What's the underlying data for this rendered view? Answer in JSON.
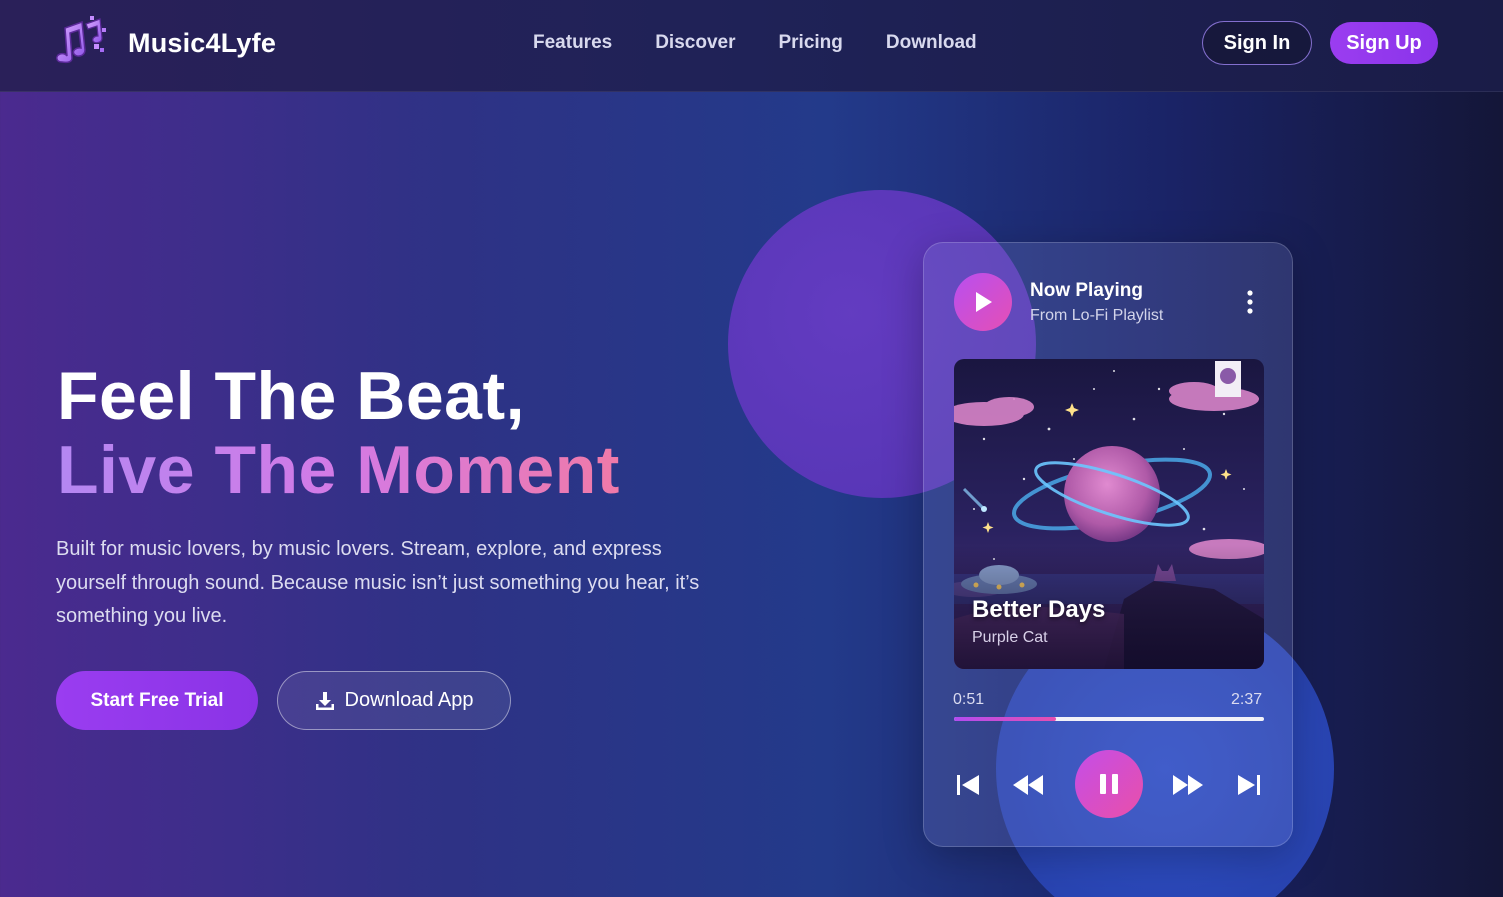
{
  "brand": {
    "name": "Music4Lyfe",
    "logo_icon": "music-notes-logo-icon"
  },
  "nav": {
    "links": [
      "Features",
      "Discover",
      "Pricing",
      "Download"
    ],
    "sign_in": "Sign In",
    "sign_up": "Sign Up"
  },
  "hero": {
    "headline_1": "Feel The Beat,",
    "headline_2": "Live The Moment",
    "description": "Built for music lovers, by music lovers. Stream, explore, and express yourself through sound. Because music isn’t just something you hear, it’s something you live.",
    "cta_primary": "Start Free Trial",
    "cta_secondary": "Download App",
    "cta_secondary_icon": "download-icon"
  },
  "player": {
    "status": "Now Playing",
    "source": "From Lo-Fi Playlist",
    "song_title": "Better Days",
    "artist": "Purple Cat",
    "current_time": "0:51",
    "total_time": "2:37",
    "progress": 0.33,
    "controls": [
      "skip-previous-icon",
      "rewind-icon",
      "pause-icon",
      "fast-forward-icon",
      "skip-next-icon"
    ]
  },
  "colors": {
    "accent_purple": "#9b3df0",
    "accent_pink": "#e94fa9",
    "headline_gradient_start": "#b487f2",
    "headline_gradient_end": "#f07aa8"
  }
}
